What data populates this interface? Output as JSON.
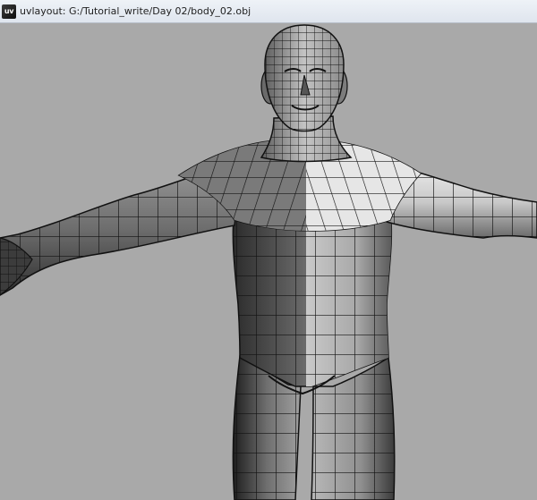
{
  "window": {
    "title": "uvlayout: G:/Tutorial_write/Day 02/body_02.obj",
    "icon_label": "uv",
    "icon_name": "uvlayout-app-icon"
  },
  "viewport": {
    "background_color": "#a9a9a9",
    "content": "3d-model",
    "render_style": "faceted-wireframe",
    "wire_color": "#111111"
  }
}
